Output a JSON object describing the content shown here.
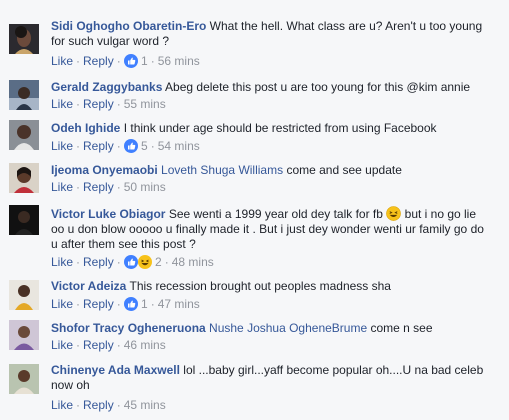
{
  "comments": [
    {
      "author": "Sidi Oghogho Obaretin-Ero",
      "text_line1": "What the hell. What class are u? Aren't u too young",
      "text_line2": "for such vulgar word ?",
      "like": "Like",
      "reply": "Reply",
      "reaction_count": "1",
      "time": "56 mins"
    },
    {
      "author": "Gerald Zaggybanks",
      "text": "Abeg delete this post u are too young for this @kim annie",
      "like": "Like",
      "reply": "Reply",
      "time": "55 mins"
    },
    {
      "author": "Odeh Ighide",
      "text": "I think under age should be restricted from using Facebook",
      "like": "Like",
      "reply": "Reply",
      "reaction_count": "5",
      "time": "54 mins"
    },
    {
      "author": "Ijeoma Onyemaobi",
      "tag": "Loveth Shuga Williams",
      "text": "come and see update",
      "like": "Like",
      "reply": "Reply",
      "time": "50 mins"
    },
    {
      "author": "Victor Luke Obiagor",
      "text_line1": "See wenti a 1999 year old dey talk for fb",
      "text_line1b": "but i no go lie",
      "text_line2": "oo u don blow ooooo u finally made it . But i just dey wonder wenti ur family go do",
      "text_line3": "u after them see this post ?",
      "like": "Like",
      "reply": "Reply",
      "reaction_count": "2",
      "time": "48 mins"
    },
    {
      "author": "Victor Adeiza",
      "text": "This recession brought out peoples madness sha",
      "like": "Like",
      "reply": "Reply",
      "reaction_count": "1",
      "time": "47 mins"
    },
    {
      "author": "Shofor Tracy Ogheneruona",
      "tag": "Nushe Joshua OgheneBrume",
      "text": "come n see",
      "like": "Like",
      "reply": "Reply",
      "time": "46 mins"
    },
    {
      "author": "Chinenye Ada Maxwell",
      "text_line1": "lol ...baby girl...yaff become popular oh....U na bad celeb",
      "text_line2": "now oh",
      "like": "Like",
      "reply": "Reply",
      "time": "45 mins"
    }
  ],
  "colors": {
    "link": "#365899",
    "text": "#1d2129",
    "meta": "#90949c",
    "background": "#f6f7f9",
    "like_blue": "#4080ff",
    "haha_yellow": "#f7c21a"
  }
}
